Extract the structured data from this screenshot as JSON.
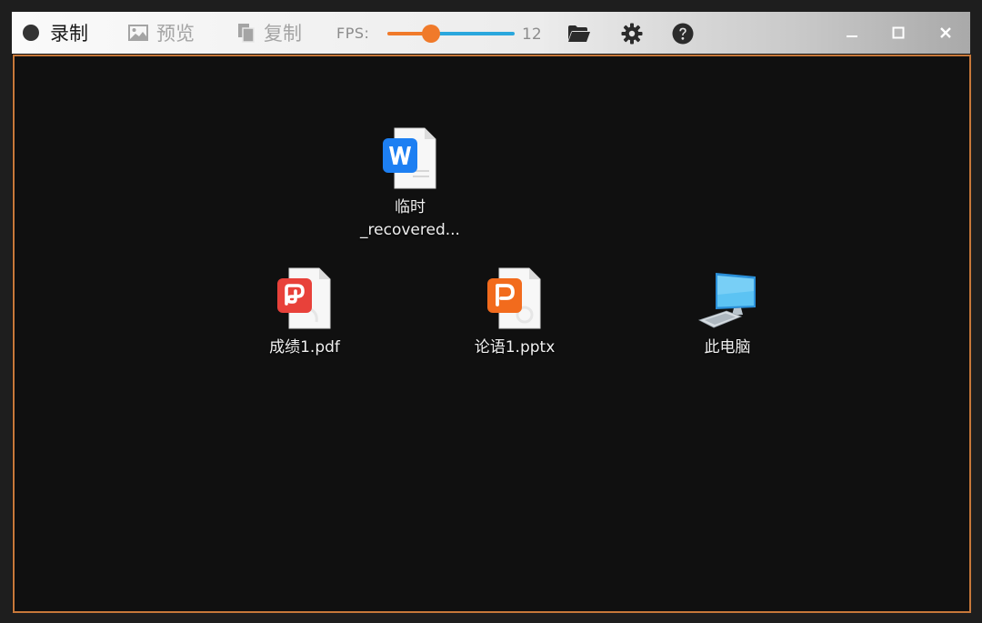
{
  "toolbar": {
    "record_label": "录制",
    "preview_label": "预览",
    "copy_label": "复制",
    "fps_label": "FPS:",
    "fps_value": "12",
    "fps_slider_fraction": 0.34
  },
  "icons": {
    "record": "record-dot-icon",
    "preview": "image-icon",
    "copy": "copy-icon",
    "open_folder": "folder-open-icon",
    "settings": "gear-icon",
    "help": "help-icon",
    "minimize": "minimize-icon",
    "maximize": "maximize-icon",
    "close": "close-icon"
  },
  "colors": {
    "slider_fill": "#f07a2a",
    "slider_rest": "#2aa7dd",
    "content_border": "#c7783a"
  },
  "desktop": {
    "items": [
      {
        "line1": "临时",
        "line2": "_recovered...",
        "type": "word-doc-icon"
      },
      {
        "line1": "成绩1.pdf",
        "line2": "",
        "type": "pdf-icon"
      },
      {
        "line1": "论语1.pptx",
        "line2": "",
        "type": "pptx-icon"
      },
      {
        "line1": "此电脑",
        "line2": "",
        "type": "this-pc-icon"
      }
    ]
  }
}
